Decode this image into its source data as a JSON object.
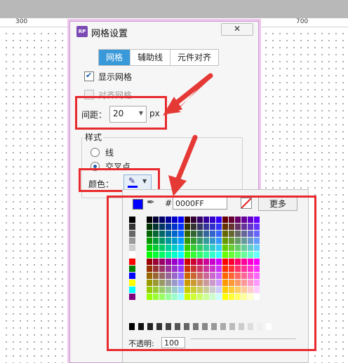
{
  "ruler": {
    "labels": [
      "300",
      "700"
    ]
  },
  "dialog": {
    "icon_text": "RP",
    "title": "网格设置",
    "close_label": "✕",
    "tabs": [
      {
        "label": "网格",
        "active": true
      },
      {
        "label": "辅助线",
        "active": false
      },
      {
        "label": "元件对齐",
        "active": false
      }
    ],
    "show_grid": {
      "label": "显示网格",
      "checked": true
    },
    "snap_grid": {
      "label": "对齐网格",
      "checked": false
    },
    "spacing": {
      "label": "间距：",
      "value": "20",
      "unit": "px"
    },
    "style_group": {
      "title": "样式",
      "options": [
        {
          "label": "线",
          "selected": false
        },
        {
          "label": "交叉点",
          "selected": true
        }
      ]
    },
    "color": {
      "label": "颜色：",
      "value": "#0000FF"
    }
  },
  "picker": {
    "hash": "#",
    "hex_value": "0000FF",
    "more_label": "更多",
    "opacity_label": "不透明:",
    "opacity_value": "100",
    "current_color": "#0000FF",
    "left_column": [
      "#000000",
      "#333333",
      "#666666",
      "#999999",
      "#cccccc",
      "#ffffff",
      "#ff0000",
      "#008000",
      "#0000ff",
      "#ffff00",
      "#00ffff",
      "#800080"
    ],
    "gray_row": [
      "#000000",
      "#111111",
      "#222222",
      "#333333",
      "#444444",
      "#555555",
      "#666666",
      "#777777",
      "#888888",
      "#999999",
      "#aaaaaa",
      "#bbbbbb",
      "#cccccc",
      "#dddddd",
      "#eeeeee",
      "#ffffff"
    ]
  }
}
